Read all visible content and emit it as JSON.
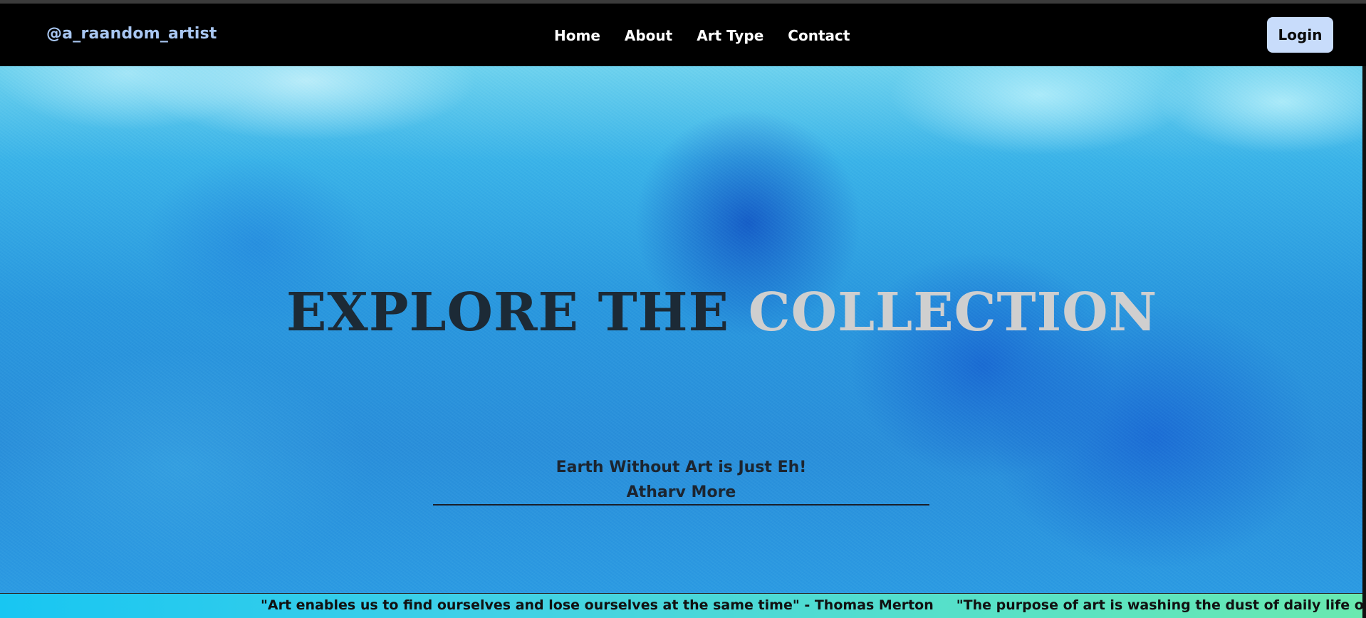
{
  "brand": {
    "name": "@a_raandom_artist"
  },
  "nav": {
    "items": [
      {
        "label": "Home"
      },
      {
        "label": "About"
      },
      {
        "label": "Art Type"
      },
      {
        "label": "Contact"
      }
    ],
    "login_label": "Login"
  },
  "hero": {
    "title_part_1": "EXPLORE THE ",
    "title_part_2": "COLLECTION",
    "subtitle_line_1": "Earth Without Art is Just Eh!",
    "subtitle_line_2": "Atharv More"
  },
  "ticker": {
    "quotes": [
      "\"Art enables us to find ourselves and lose ourselves at the same time\" - Thomas Merton",
      "\"The purpose of art is washing the dust of daily life off our souls.\" - Pablo"
    ]
  },
  "colors": {
    "navbar_background": "#000000",
    "brand_text": "#a9c7f2",
    "login_background": "#c8dcfb",
    "title_dark": "#1c2a36",
    "title_light": "#cfcfcf",
    "hero_base": "#2a98de",
    "ticker_start": "#18c6f2",
    "ticker_end": "#69e9b0"
  }
}
